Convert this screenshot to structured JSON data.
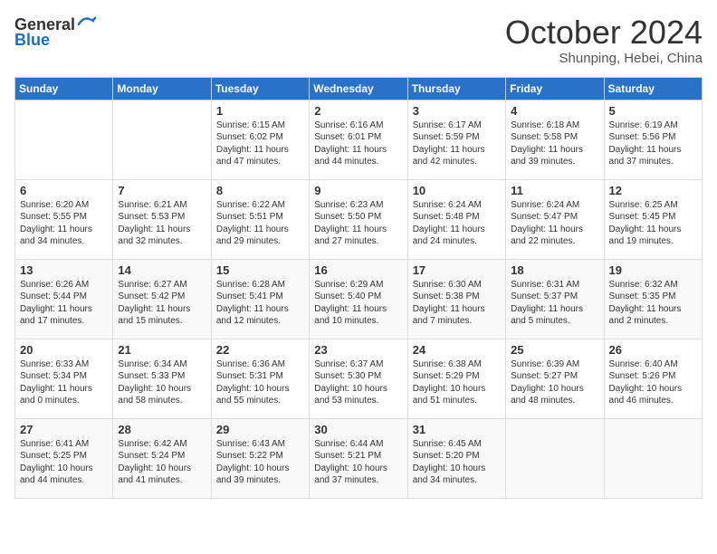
{
  "header": {
    "logo_general": "General",
    "logo_blue": "Blue",
    "month": "October 2024",
    "location": "Shunping, Hebei, China"
  },
  "weekdays": [
    "Sunday",
    "Monday",
    "Tuesday",
    "Wednesday",
    "Thursday",
    "Friday",
    "Saturday"
  ],
  "weeks": [
    [
      {
        "day": "",
        "content": ""
      },
      {
        "day": "",
        "content": ""
      },
      {
        "day": "1",
        "content": "Sunrise: 6:15 AM\nSunset: 6:02 PM\nDaylight: 11 hours and 47 minutes."
      },
      {
        "day": "2",
        "content": "Sunrise: 6:16 AM\nSunset: 6:01 PM\nDaylight: 11 hours and 44 minutes."
      },
      {
        "day": "3",
        "content": "Sunrise: 6:17 AM\nSunset: 5:59 PM\nDaylight: 11 hours and 42 minutes."
      },
      {
        "day": "4",
        "content": "Sunrise: 6:18 AM\nSunset: 5:58 PM\nDaylight: 11 hours and 39 minutes."
      },
      {
        "day": "5",
        "content": "Sunrise: 6:19 AM\nSunset: 5:56 PM\nDaylight: 11 hours and 37 minutes."
      }
    ],
    [
      {
        "day": "6",
        "content": "Sunrise: 6:20 AM\nSunset: 5:55 PM\nDaylight: 11 hours and 34 minutes."
      },
      {
        "day": "7",
        "content": "Sunrise: 6:21 AM\nSunset: 5:53 PM\nDaylight: 11 hours and 32 minutes."
      },
      {
        "day": "8",
        "content": "Sunrise: 6:22 AM\nSunset: 5:51 PM\nDaylight: 11 hours and 29 minutes."
      },
      {
        "day": "9",
        "content": "Sunrise: 6:23 AM\nSunset: 5:50 PM\nDaylight: 11 hours and 27 minutes."
      },
      {
        "day": "10",
        "content": "Sunrise: 6:24 AM\nSunset: 5:48 PM\nDaylight: 11 hours and 24 minutes."
      },
      {
        "day": "11",
        "content": "Sunrise: 6:24 AM\nSunset: 5:47 PM\nDaylight: 11 hours and 22 minutes."
      },
      {
        "day": "12",
        "content": "Sunrise: 6:25 AM\nSunset: 5:45 PM\nDaylight: 11 hours and 19 minutes."
      }
    ],
    [
      {
        "day": "13",
        "content": "Sunrise: 6:26 AM\nSunset: 5:44 PM\nDaylight: 11 hours and 17 minutes."
      },
      {
        "day": "14",
        "content": "Sunrise: 6:27 AM\nSunset: 5:42 PM\nDaylight: 11 hours and 15 minutes."
      },
      {
        "day": "15",
        "content": "Sunrise: 6:28 AM\nSunset: 5:41 PM\nDaylight: 11 hours and 12 minutes."
      },
      {
        "day": "16",
        "content": "Sunrise: 6:29 AM\nSunset: 5:40 PM\nDaylight: 11 hours and 10 minutes."
      },
      {
        "day": "17",
        "content": "Sunrise: 6:30 AM\nSunset: 5:38 PM\nDaylight: 11 hours and 7 minutes."
      },
      {
        "day": "18",
        "content": "Sunrise: 6:31 AM\nSunset: 5:37 PM\nDaylight: 11 hours and 5 minutes."
      },
      {
        "day": "19",
        "content": "Sunrise: 6:32 AM\nSunset: 5:35 PM\nDaylight: 11 hours and 2 minutes."
      }
    ],
    [
      {
        "day": "20",
        "content": "Sunrise: 6:33 AM\nSunset: 5:34 PM\nDaylight: 11 hours and 0 minutes."
      },
      {
        "day": "21",
        "content": "Sunrise: 6:34 AM\nSunset: 5:33 PM\nDaylight: 10 hours and 58 minutes."
      },
      {
        "day": "22",
        "content": "Sunrise: 6:36 AM\nSunset: 5:31 PM\nDaylight: 10 hours and 55 minutes."
      },
      {
        "day": "23",
        "content": "Sunrise: 6:37 AM\nSunset: 5:30 PM\nDaylight: 10 hours and 53 minutes."
      },
      {
        "day": "24",
        "content": "Sunrise: 6:38 AM\nSunset: 5:29 PM\nDaylight: 10 hours and 51 minutes."
      },
      {
        "day": "25",
        "content": "Sunrise: 6:39 AM\nSunset: 5:27 PM\nDaylight: 10 hours and 48 minutes."
      },
      {
        "day": "26",
        "content": "Sunrise: 6:40 AM\nSunset: 5:26 PM\nDaylight: 10 hours and 46 minutes."
      }
    ],
    [
      {
        "day": "27",
        "content": "Sunrise: 6:41 AM\nSunset: 5:25 PM\nDaylight: 10 hours and 44 minutes."
      },
      {
        "day": "28",
        "content": "Sunrise: 6:42 AM\nSunset: 5:24 PM\nDaylight: 10 hours and 41 minutes."
      },
      {
        "day": "29",
        "content": "Sunrise: 6:43 AM\nSunset: 5:22 PM\nDaylight: 10 hours and 39 minutes."
      },
      {
        "day": "30",
        "content": "Sunrise: 6:44 AM\nSunset: 5:21 PM\nDaylight: 10 hours and 37 minutes."
      },
      {
        "day": "31",
        "content": "Sunrise: 6:45 AM\nSunset: 5:20 PM\nDaylight: 10 hours and 34 minutes."
      },
      {
        "day": "",
        "content": ""
      },
      {
        "day": "",
        "content": ""
      }
    ]
  ]
}
